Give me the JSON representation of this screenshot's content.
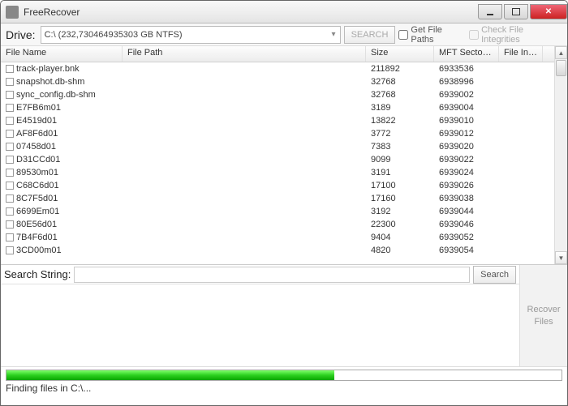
{
  "window": {
    "title": "FreeRecover"
  },
  "drive": {
    "label": "Drive:",
    "selected": "C:\\ (232,730464935303 GB NTFS)",
    "search_btn": "SEARCH",
    "get_paths_label": "Get File Paths",
    "check_integ_label": "Check File Integrities"
  },
  "columns": {
    "file_name": "File Name",
    "file_path": "File Path",
    "size": "Size",
    "mft": "MFT Sector ...",
    "integ": "File Inte..."
  },
  "rows": [
    {
      "name": "track-player.bnk",
      "path": "",
      "size": "211892",
      "mft": "6933536",
      "int": ""
    },
    {
      "name": "snapshot.db-shm",
      "path": "",
      "size": "32768",
      "mft": "6938996",
      "int": ""
    },
    {
      "name": "sync_config.db-shm",
      "path": "",
      "size": "32768",
      "mft": "6939002",
      "int": ""
    },
    {
      "name": "E7FB6m01",
      "path": "",
      "size": "3189",
      "mft": "6939004",
      "int": ""
    },
    {
      "name": "E4519d01",
      "path": "",
      "size": "13822",
      "mft": "6939010",
      "int": ""
    },
    {
      "name": "AF8F6d01",
      "path": "",
      "size": "3772",
      "mft": "6939012",
      "int": ""
    },
    {
      "name": "07458d01",
      "path": "",
      "size": "7383",
      "mft": "6939020",
      "int": ""
    },
    {
      "name": "D31CCd01",
      "path": "",
      "size": "9099",
      "mft": "6939022",
      "int": ""
    },
    {
      "name": "89530m01",
      "path": "",
      "size": "3191",
      "mft": "6939024",
      "int": ""
    },
    {
      "name": "C68C6d01",
      "path": "",
      "size": "17100",
      "mft": "6939026",
      "int": ""
    },
    {
      "name": "8C7F5d01",
      "path": "",
      "size": "17160",
      "mft": "6939038",
      "int": ""
    },
    {
      "name": "6699Em01",
      "path": "",
      "size": "3192",
      "mft": "6939044",
      "int": ""
    },
    {
      "name": "80E56d01",
      "path": "",
      "size": "22300",
      "mft": "6939046",
      "int": ""
    },
    {
      "name": "7B4F6d01",
      "path": "",
      "size": "9404",
      "mft": "6939052",
      "int": ""
    },
    {
      "name": "3CD00m01",
      "path": "",
      "size": "4820",
      "mft": "6939054",
      "int": ""
    }
  ],
  "search": {
    "label": "Search String:",
    "value": "",
    "btn": "Search"
  },
  "recover": {
    "label": "Recover\nFiles"
  },
  "status": {
    "text": "Finding files in C:\\..."
  }
}
